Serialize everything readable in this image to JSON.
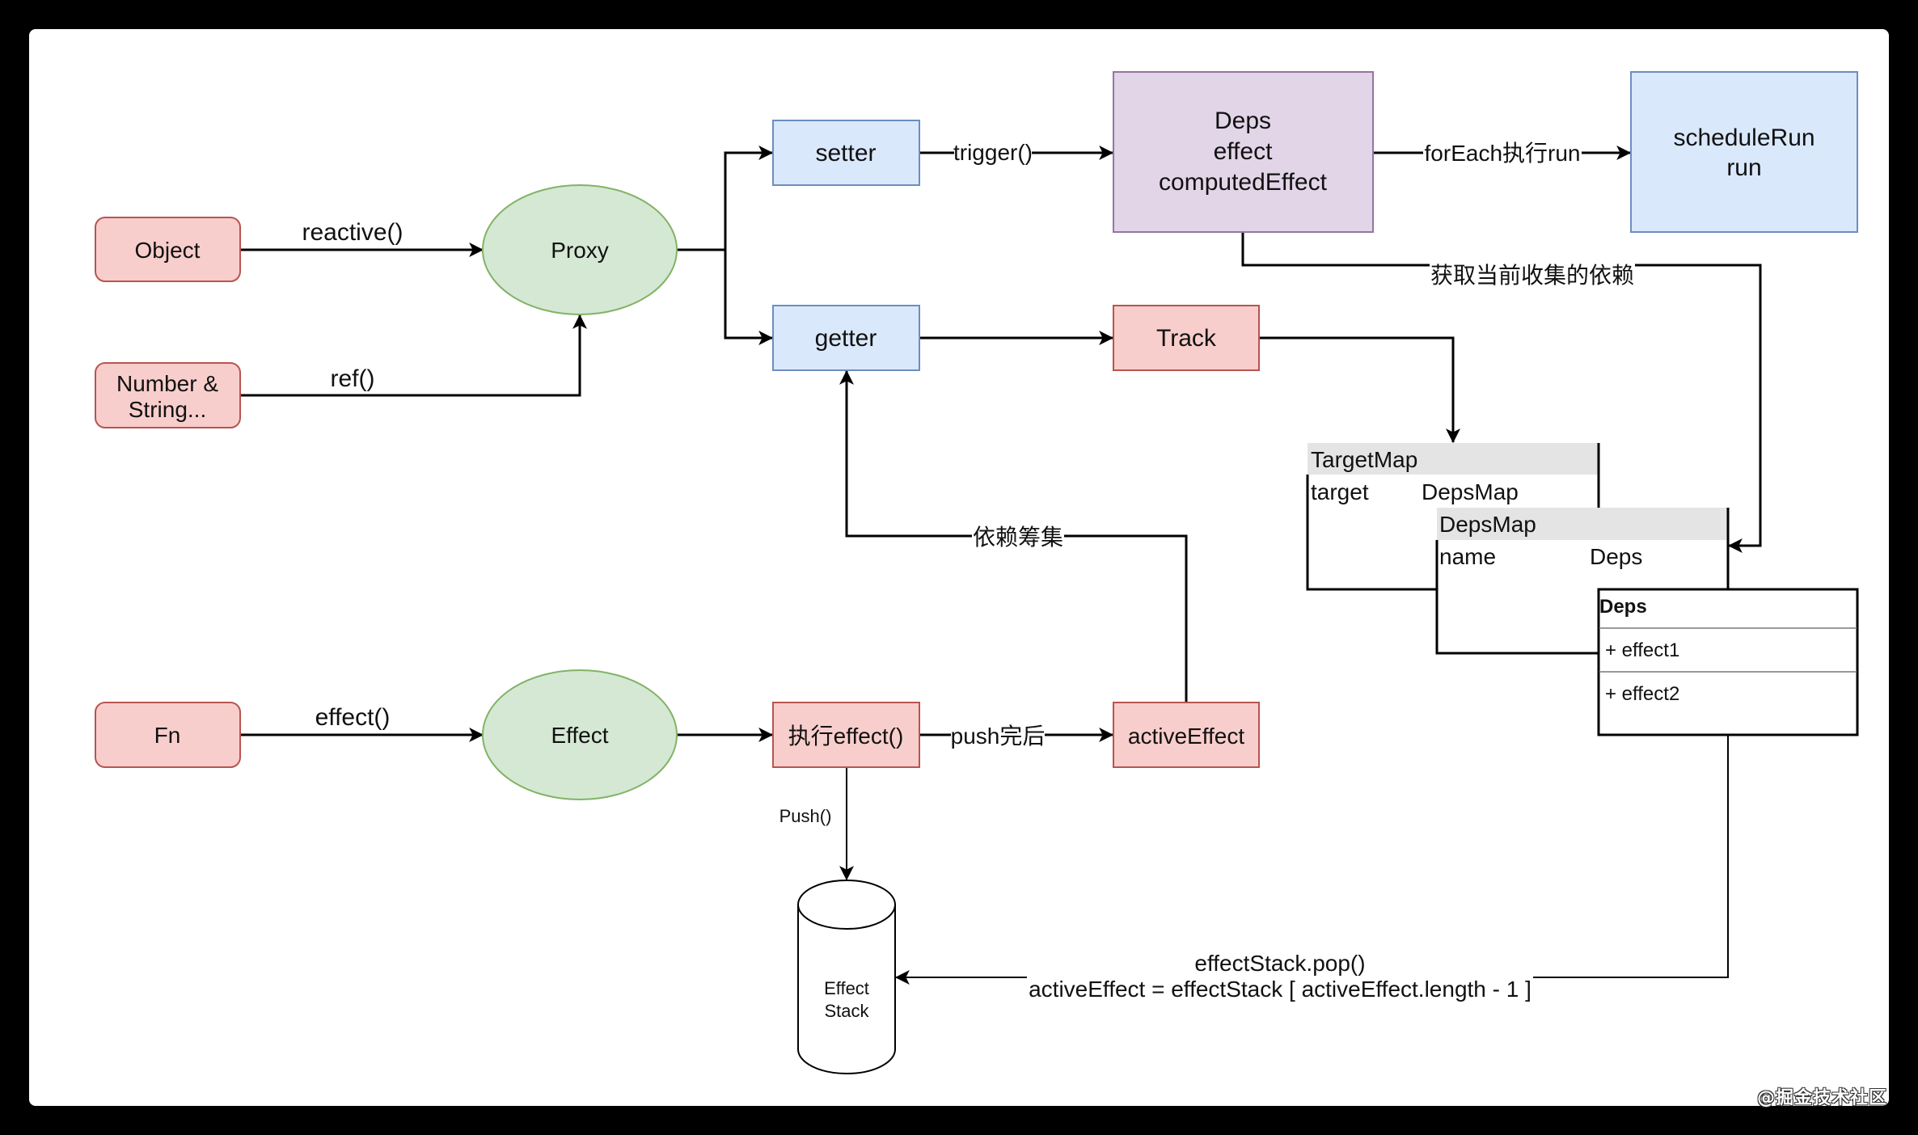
{
  "colors": {
    "red_fill": "#f8cecc",
    "red_stroke": "#b85450",
    "blue_fill": "#dae8fc",
    "blue_stroke": "#6c8ebf",
    "green_fill": "#d5e8d4",
    "green_stroke": "#82b366",
    "purple_fill": "#e1d5e7",
    "purple_stroke": "#9673a6",
    "header_gray": "#e4e4e4",
    "line": "#000000"
  },
  "nodes": {
    "object": "Object",
    "number_string": [
      "Number &",
      "String..."
    ],
    "proxy": "Proxy",
    "setter": "setter",
    "getter": "getter",
    "deps": [
      "Deps",
      "effect",
      "computedEffect"
    ],
    "schedule_run": [
      "scheduleRun",
      "run"
    ],
    "track": "Track",
    "fn": "Fn",
    "effect": "Effect",
    "exec_effect": "执行effect()",
    "active_effect": "activeEffect",
    "effect_stack": [
      "Effect",
      "Stack"
    ]
  },
  "edges": {
    "reactive": "reactive()",
    "ref": "ref()",
    "trigger": "trigger()",
    "for_each_run": "forEach执行run",
    "get_current_deps": "获取当前收集的依赖",
    "dep_collect": "依赖筹集",
    "effect_call": "effect()",
    "push_done": "push完后",
    "push": "Push()",
    "pop_line1": "effectStack.pop()",
    "pop_line2": "activeEffect = effectStack [ activeEffect.length - 1 ]"
  },
  "target_map": {
    "title": "TargetMap",
    "key_col": "target",
    "value_col": "DepsMap"
  },
  "deps_map": {
    "title": "DepsMap",
    "key_col": "name",
    "value_col": "Deps"
  },
  "deps_table": {
    "title": "Deps",
    "items": [
      "+ effect1",
      "+ effect2"
    ]
  },
  "watermark": "@掘金技术社区"
}
